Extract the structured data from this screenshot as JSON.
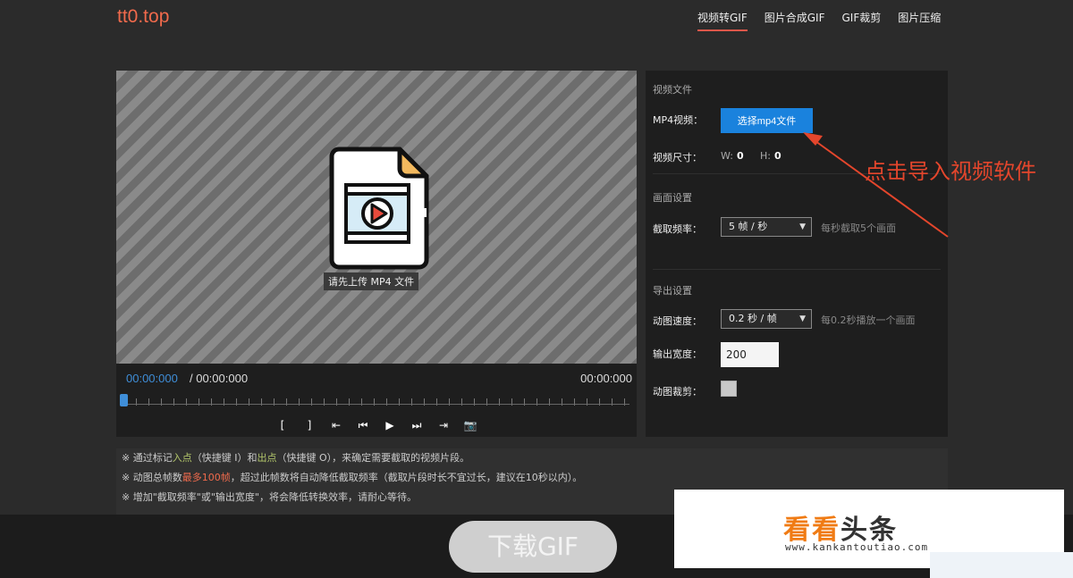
{
  "header": {
    "logo": "tt0.top",
    "nav": [
      {
        "label": "视频转GIF",
        "active": true
      },
      {
        "label": "图片合成GIF",
        "active": false
      },
      {
        "label": "GIF裁剪",
        "active": false
      },
      {
        "label": "图片压缩",
        "active": false
      }
    ]
  },
  "preview": {
    "upload_hint": "请先上传 MP4 文件",
    "icon": "video-file-icon"
  },
  "player": {
    "current_time": "00:00:000",
    "total_time": "/ 00:00:000",
    "end_time": "00:00:000",
    "controls": [
      {
        "name": "mark-in-icon",
        "glyph": "["
      },
      {
        "name": "mark-out-icon",
        "glyph": "]"
      },
      {
        "name": "go-to-in-icon",
        "glyph": "⇤"
      },
      {
        "name": "previous-frame-icon",
        "glyph": "⏮"
      },
      {
        "name": "play-icon",
        "glyph": "▶"
      },
      {
        "name": "next-frame-icon",
        "glyph": "⏭"
      },
      {
        "name": "go-to-out-icon",
        "glyph": "⇥"
      },
      {
        "name": "camera-icon",
        "glyph": "📷"
      }
    ]
  },
  "settings": {
    "video_section": "视频文件",
    "mp4_label": "MP4视频：",
    "choose_button": "选择mp4文件",
    "size_label": "视频尺寸：",
    "width_prefix": "W:",
    "width_value": "0",
    "height_prefix": "H:",
    "height_value": "0",
    "frame_section": "画面设置",
    "rate_label": "截取频率：",
    "rate_value": "5 帧 / 秒",
    "rate_hint": "每秒截取5个画面",
    "export_section": "导出设置",
    "speed_label": "动图速度：",
    "speed_value": "0.2 秒 / 帧",
    "speed_hint": "每0.2秒播放一个画面",
    "output_width_label": "输出宽度：",
    "output_width_value": "200",
    "crop_label": "动图裁剪："
  },
  "notes": {
    "n1_a": "※ 通过标记",
    "n1_in": "入点",
    "n1_b": "（快捷键 I）和",
    "n1_out": "出点",
    "n1_c": "（快捷键 O），来确定需要截取的视频片段。",
    "n2_a": "※ 动图总帧数",
    "n2_max": "最多100帧",
    "n2_b": "，超过此帧数将自动降低截取频率（截取片段时长不宜过长，建议在10秒以内）。",
    "n3": "※ 增加\"截取频率\"或\"输出宽度\"，将会降低转换效率，请耐心等待。"
  },
  "footer": {
    "download_button": "下载GIF"
  },
  "annotation": {
    "text": "点击导入视频软件",
    "color": "#e4462c"
  },
  "watermark": {
    "title_orange": "看看",
    "title_dark": "头条",
    "url": "www.kankantoutiao.com"
  },
  "colors": {
    "accent_blue": "#1a82dd",
    "logo_orange": "#f06a4c",
    "background": "#2b2b2b"
  }
}
